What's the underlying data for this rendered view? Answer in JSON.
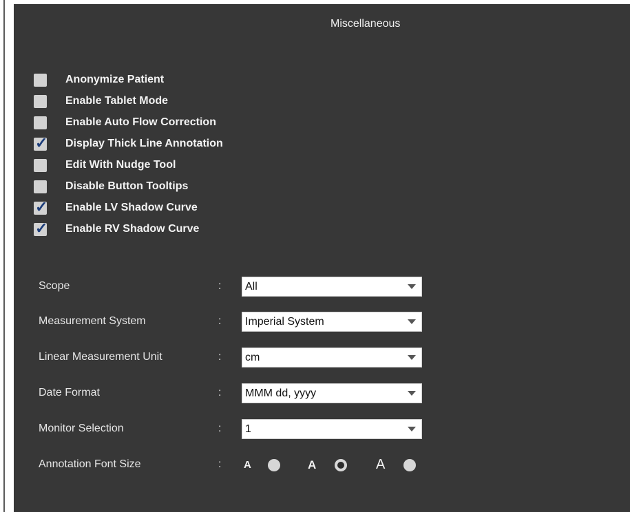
{
  "panel": {
    "title": "Miscellaneous"
  },
  "checkboxes": [
    {
      "label": "Anonymize Patient",
      "checked": false
    },
    {
      "label": "Enable Tablet Mode",
      "checked": false
    },
    {
      "label": "Enable Auto Flow Correction",
      "checked": false
    },
    {
      "label": "Display Thick Line Annotation",
      "checked": true
    },
    {
      "label": "Edit With Nudge Tool",
      "checked": false
    },
    {
      "label": "Disable Button Tooltips",
      "checked": false
    },
    {
      "label": "Enable LV Shadow Curve",
      "checked": true
    },
    {
      "label": "Enable RV Shadow Curve",
      "checked": true
    }
  ],
  "check_glyph": "✓",
  "separator": ":",
  "fields": {
    "scope": {
      "label": "Scope",
      "value": "All"
    },
    "measurement_system": {
      "label": "Measurement System",
      "value": "Imperial System"
    },
    "linear_unit": {
      "label": "Linear Measurement Unit",
      "value": "cm"
    },
    "date_format": {
      "label": "Date Format",
      "value": "MMM dd, yyyy"
    },
    "monitor": {
      "label": "Monitor Selection",
      "value": "1"
    },
    "annotation_font": {
      "label": "Annotation Font Size",
      "options": [
        {
          "glyph": "A",
          "size": "small",
          "selected": false
        },
        {
          "glyph": "A",
          "size": "medium",
          "selected": true
        },
        {
          "glyph": "A",
          "size": "large",
          "selected": false
        }
      ]
    }
  },
  "colors": {
    "background": "#373737",
    "text": "#f3f3f3",
    "check": "#1c3d7a"
  }
}
